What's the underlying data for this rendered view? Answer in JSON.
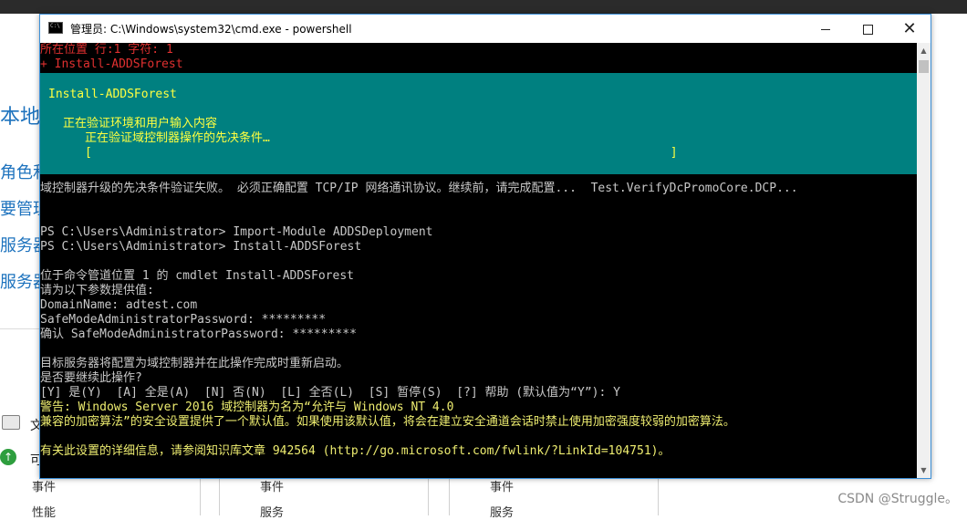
{
  "background": {
    "fragments_left": [
      "本地",
      "角色和",
      "要管理",
      "服务器",
      "服务器"
    ],
    "lower_label": "文",
    "status_label": "可",
    "panes": [
      {
        "row1": "事件",
        "row2": "性能"
      },
      {
        "row1": "事件",
        "row2": "服务"
      },
      {
        "row1": "事件",
        "row2": "服务"
      }
    ],
    "watermark": "CSDN @Struggle。"
  },
  "window": {
    "title": "管理员: C:\\Windows\\system32\\cmd.exe - powershell",
    "minimize_label": "—",
    "maximize_label": "□",
    "close_label": "✕"
  },
  "console": {
    "error_header": [
      "所在位置 行:1 字符: 1",
      "+ Install-ADDSForest"
    ],
    "progress": {
      "activity": "Install-ADDSForest",
      "status": "正在验证环境和用户输入内容",
      "operation": "正在验证域控制器操作的先决条件…",
      "bar": "[                                                                                 ]"
    },
    "lines": [
      {
        "text": "域控制器升级的先决条件验证失败。 必须正确配置 TCP/IP 网络通讯协议。继续前，请完成配置...  Test.VerifyDcPromoCore.DCP...",
        "color": "gray",
        "row": 0
      },
      {
        "text": "PS C:\\Users\\Administrator> Import-Module ADDSDeployment",
        "color": "gray",
        "row": 3,
        "cmd": true
      },
      {
        "text": "PS C:\\Users\\Administrator> Install-ADDSForest",
        "color": "gray",
        "row": 4,
        "cmd": true
      },
      {
        "text": "位于命令管道位置 1 的 cmdlet Install-ADDSForest",
        "color": "gray",
        "row": 6
      },
      {
        "text": "请为以下参数提供值:",
        "color": "gray",
        "row": 7
      },
      {
        "text": "DomainName: adtest.com",
        "color": "gray",
        "row": 8
      },
      {
        "text": "SafeModeAdministratorPassword: *********",
        "color": "gray",
        "row": 9
      },
      {
        "text": "确认 SafeModeAdministratorPassword: *********",
        "color": "gray",
        "row": 10
      },
      {
        "text": "目标服务器将配置为域控制器并在此操作完成时重新启动。",
        "color": "gray",
        "row": 12
      },
      {
        "text": "是否要继续此操作?",
        "color": "gray",
        "row": 13
      },
      {
        "text": "[Y] 是(Y)  [A] 全是(A)  [N] 否(N)  [L] 全否(L)  [S] 暂停(S)  [?] 帮助 (默认值为“Y”): Y",
        "color": "gray",
        "row": 14
      },
      {
        "text": "警告: Windows Server 2016 域控制器为名为“允许与 Windows NT 4.0",
        "color": "yellow",
        "row": 15
      },
      {
        "text": "兼容的加密算法”的安全设置提供了一个默认值。如果使用该默认值，将会在建立安全通道会话时禁止使用加密强度较弱的加密算法。",
        "color": "yellow",
        "row": 16
      },
      {
        "text": "有关此设置的详细信息，请参阅知识库文章 942564 (http://go.microsoft.com/fwlink/?LinkId=104751)。",
        "color": "yellow",
        "row": 18
      }
    ]
  }
}
